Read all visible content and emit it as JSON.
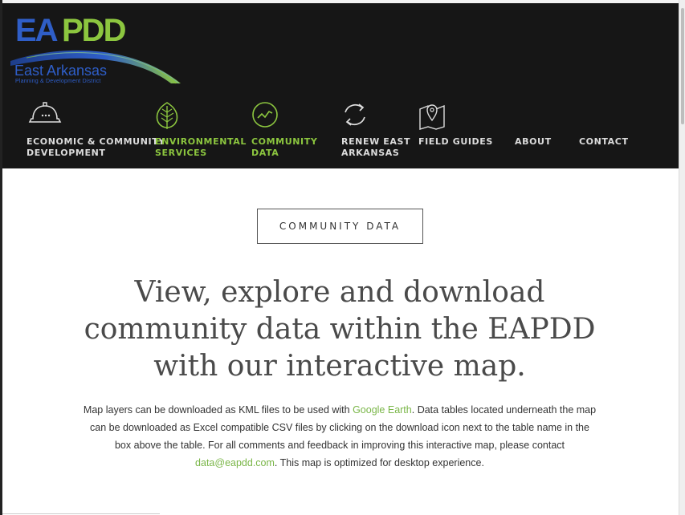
{
  "logo": {
    "ea": "EA",
    "pdd": "PDD",
    "region": "East Arkansas",
    "subtitle": "Planning & Development District",
    "alt_icon": "eapdd-logo-swoosh"
  },
  "nav": [
    {
      "id": "economic",
      "icon": "hardhat-icon",
      "line1": "Economic & Community",
      "line2": "Development",
      "active": false
    },
    {
      "id": "environmental",
      "icon": "leaf-icon",
      "line1": "Environmental",
      "line2": "Services",
      "active": true
    },
    {
      "id": "community",
      "icon": "chart-circle-icon",
      "line1": "Community",
      "line2": "Data",
      "active": true
    },
    {
      "id": "renew",
      "icon": "refresh-icon",
      "line1": "reNEW East",
      "line2": "Arkansas",
      "active": false
    },
    {
      "id": "fieldguides",
      "icon": "map-pin-icon",
      "line1": "Field Guides",
      "line2": "",
      "active": false
    },
    {
      "id": "about",
      "icon": "",
      "line1": "About",
      "line2": "",
      "active": false
    },
    {
      "id": "contact",
      "icon": "",
      "line1": "Contact",
      "line2": "",
      "active": false
    }
  ],
  "section_button": "COMMUNITY DATA",
  "headline": "View, explore and download community data within the EAPDD with our interactive map.",
  "paragraph": {
    "p1": "Map layers can be downloaded as KML files to be used with ",
    "link1": "Google Earth",
    "p2": ". Data tables located underneath the map can be downloaded as Excel compatible CSV files by clicking on the download icon next to the table name in the box above the table. For all comments and feedback in improving this interactive map, please contact ",
    "link2": "data@eapdd.com",
    "p3": ". This map is optimized for desktop experience."
  },
  "colors": {
    "accent_green": "#8cc63f",
    "brand_blue": "#2e5ec9",
    "header_bg": "#161616"
  }
}
